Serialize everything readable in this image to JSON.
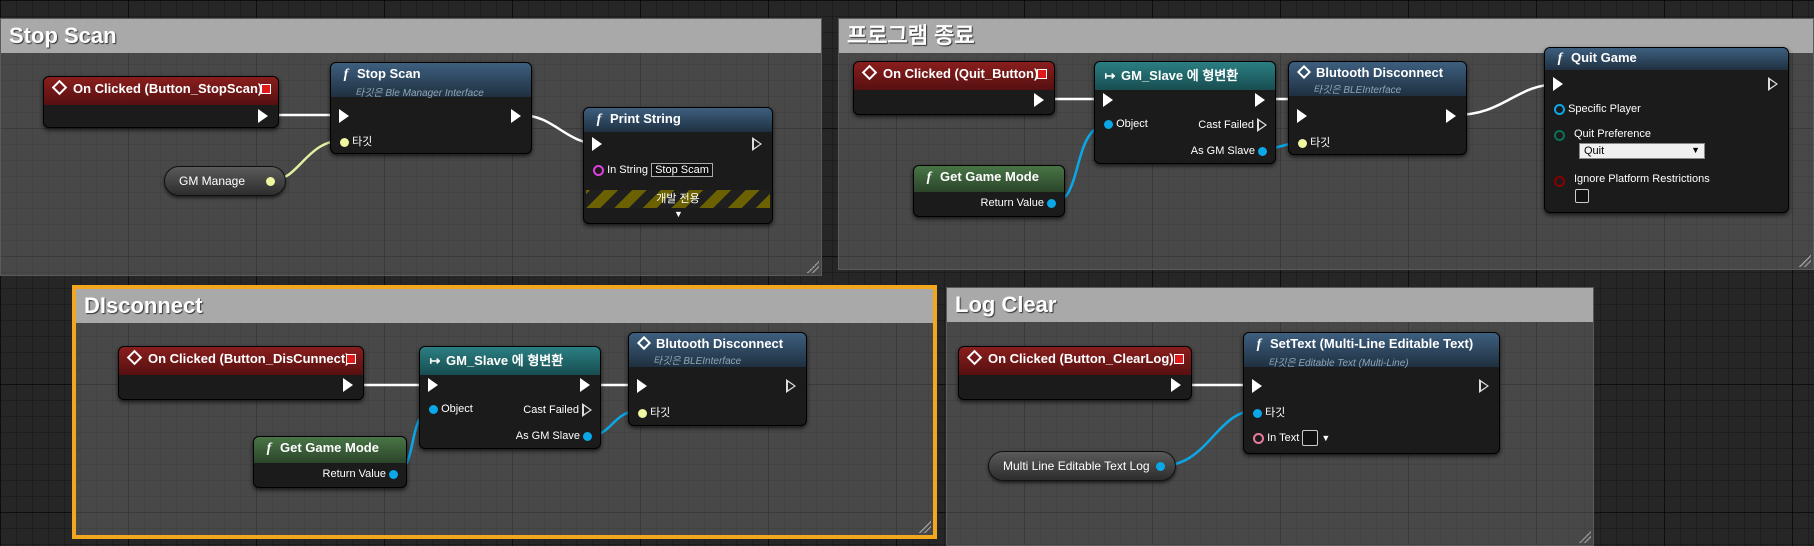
{
  "comments": {
    "stop_scan": "Stop Scan",
    "program_exit": "프로그램 종료",
    "disconnect": "DIsconnect",
    "log_clear": "Log Clear"
  },
  "stop_scan": {
    "event_title": "On Clicked (Button_StopScan)",
    "call_title": "Stop Scan",
    "call_sub": "타깃은 Ble Manager Interface",
    "call_target": "타깃",
    "var_label": "GM Manage",
    "print_title": "Print String",
    "in_string_label": "In String",
    "in_string_value": "Stop Scam",
    "dev_only": "개발 전용"
  },
  "program_exit": {
    "event_title": "On Clicked (Quit_Button)",
    "cast_title": "GM_Slave 에 형변환",
    "cast_object": "Object",
    "cast_failed": "Cast Failed",
    "cast_as": "As GM Slave",
    "disconnect_title": "Blutooth Disconnect",
    "disconnect_sub": "타깃은 BLEInterface",
    "disconnect_target": "타깃",
    "getgm_title": "Get Game Mode",
    "getgm_return": "Return Value",
    "quit_title": "Quit Game",
    "specific_player": "Specific Player",
    "quit_pref_label": "Quit Preference",
    "quit_pref_value": "Quit",
    "ignore_label": "Ignore Platform Restrictions"
  },
  "disconnect": {
    "event_title": "On Clicked (Button_DisCunnect)",
    "cast_title": "GM_Slave 에 형변환",
    "cast_object": "Object",
    "cast_failed": "Cast Failed",
    "cast_as": "As GM Slave",
    "disconnect_title": "Blutooth Disconnect",
    "disconnect_sub": "타깃은 BLEInterface",
    "disconnect_target": "타깃",
    "getgm_title": "Get Game Mode",
    "getgm_return": "Return Value"
  },
  "log_clear": {
    "event_title": "On Clicked (Button_ClearLog)",
    "settext_title": "SetText (Multi-Line Editable Text)",
    "settext_sub": "타깃은 Editable Text (Multi-Line)",
    "settext_target": "타깃",
    "in_text_label": "In Text",
    "var_label": "Multi Line Editable Text Log"
  },
  "colors": {
    "exec": "#ffffff",
    "object_pin": "#0aa8e8",
    "interface_pin": "#f0f5a0",
    "string_pin": "#e040e0",
    "byte_pin": "#0d6e5a",
    "bool_pin": "#8a0000",
    "text_pin": "#e87a9a",
    "comment_selected": "#f2a71f"
  }
}
